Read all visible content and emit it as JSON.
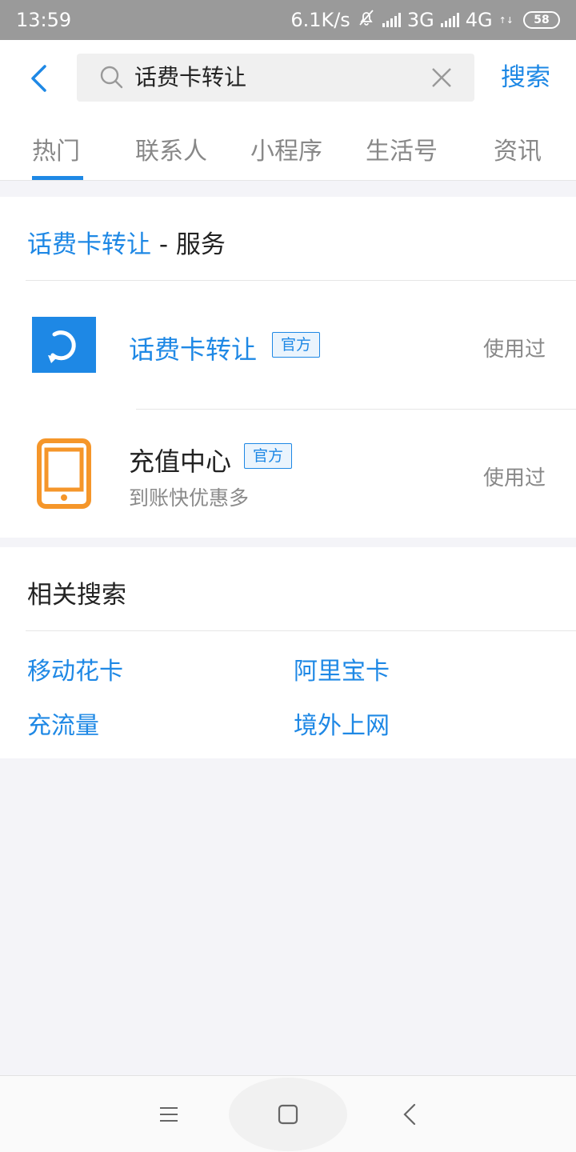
{
  "status_bar": {
    "time": "13:59",
    "net_speed": "6.1K/s",
    "net1": "3G",
    "net2": "4G",
    "battery": "58"
  },
  "search": {
    "query": "话费卡转让",
    "submit_label": "搜索"
  },
  "tabs": [
    {
      "label": "热门"
    },
    {
      "label": "联系人"
    },
    {
      "label": "小程序"
    },
    {
      "label": "生活号"
    },
    {
      "label": "资讯"
    }
  ],
  "services": {
    "title_keyword": "话费卡转让",
    "title_sep": " - ",
    "title_suffix": "服务",
    "items": [
      {
        "name": "话费卡转让",
        "badge": "官方",
        "status": "使用过",
        "subtitle": "",
        "icon": "refresh-icon",
        "icon_color": "#1e88e5",
        "name_color": "#1e88e5"
      },
      {
        "name": "充值中心",
        "badge": "官方",
        "status": "使用过",
        "subtitle": "到账快优惠多",
        "icon": "phone-icon",
        "icon_color": "#f5962a",
        "name_color": "#222222"
      }
    ]
  },
  "related": {
    "title": "相关搜索",
    "items": [
      "移动花卡",
      "阿里宝卡",
      "充流量",
      "境外上网"
    ]
  },
  "colors": {
    "accent": "#1e88e5",
    "orange": "#f5962a"
  }
}
